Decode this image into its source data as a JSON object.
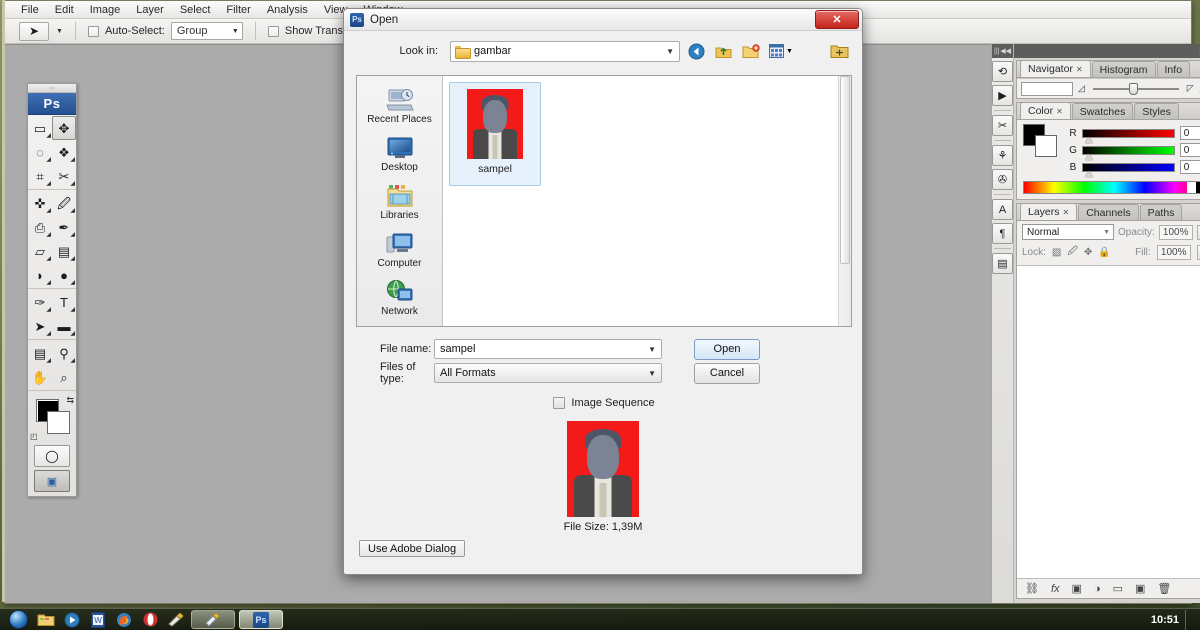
{
  "app": {
    "name": "Adobe Photoshop",
    "menus": [
      "File",
      "Edit",
      "Image",
      "Layer",
      "Select",
      "Filter",
      "Analysis",
      "View",
      "Window"
    ],
    "options_bar": {
      "tool_icon": "move-tool-icon",
      "auto_select_label": "Auto-Select:",
      "auto_select_value": "Group",
      "show_transform_label": "Show Transform Controls"
    },
    "toolbox": {
      "logo": "Ps",
      "tools": [
        {
          "name": "rectangular-marquee-tool",
          "glyph": "▭"
        },
        {
          "name": "move-tool",
          "glyph": "✥"
        },
        {
          "name": "lasso-tool",
          "glyph": "◯"
        },
        {
          "name": "magic-wand-tool",
          "glyph": "✎"
        },
        {
          "name": "crop-tool",
          "glyph": "⌗"
        },
        {
          "name": "slice-tool",
          "glyph": "✂"
        },
        {
          "name": "spot-healing-brush-tool",
          "glyph": "✜"
        },
        {
          "name": "brush-tool",
          "glyph": "🖌"
        },
        {
          "name": "clone-stamp-tool",
          "glyph": "⎙"
        },
        {
          "name": "history-brush-tool",
          "glyph": "✒"
        },
        {
          "name": "eraser-tool",
          "glyph": "▰"
        },
        {
          "name": "gradient-tool",
          "glyph": "▤"
        },
        {
          "name": "blur-tool",
          "glyph": "💧"
        },
        {
          "name": "dodge-tool",
          "glyph": "●"
        },
        {
          "name": "pen-tool",
          "glyph": "✑"
        },
        {
          "name": "type-tool",
          "glyph": "T"
        },
        {
          "name": "path-selection-tool",
          "glyph": "➤"
        },
        {
          "name": "rectangle-tool",
          "glyph": "▬"
        },
        {
          "name": "notes-tool",
          "glyph": "▤"
        },
        {
          "name": "eyedropper-tool",
          "glyph": "⚲"
        },
        {
          "name": "hand-tool",
          "glyph": "✋"
        },
        {
          "name": "zoom-tool",
          "glyph": "🔍"
        }
      ],
      "foreground_color": "#000000",
      "background_color": "#ffffff"
    },
    "canvas_color": "#ababab"
  },
  "dock": {
    "strip_icons": [
      "history-icon",
      "actions-icon",
      "tool-presets-icon",
      "clone-source-icon",
      "brushes-icon",
      "character-icon",
      "paragraph-icon",
      "layer-comps-icon"
    ],
    "navigator_panel": {
      "tabs": [
        {
          "label": "Navigator",
          "closable": true,
          "active": true
        },
        {
          "label": "Histogram",
          "closable": false,
          "active": false
        },
        {
          "label": "Info",
          "closable": false,
          "active": false
        }
      ],
      "zoom_value": ""
    },
    "color_panel": {
      "tabs": [
        {
          "label": "Color",
          "closable": true,
          "active": true
        },
        {
          "label": "Swatches",
          "closable": false,
          "active": false
        },
        {
          "label": "Styles",
          "closable": false,
          "active": false
        }
      ],
      "channels": [
        {
          "name": "R",
          "value": "0",
          "color": "#ff0000"
        },
        {
          "name": "G",
          "value": "0",
          "color": "#00ff00"
        },
        {
          "name": "B",
          "value": "0",
          "color": "#0000ff"
        }
      ],
      "foreground": "#000000",
      "background": "#ffffff"
    },
    "layers_panel": {
      "tabs": [
        {
          "label": "Layers",
          "closable": true,
          "active": true
        },
        {
          "label": "Channels",
          "closable": false,
          "active": false
        },
        {
          "label": "Paths",
          "closable": false,
          "active": false
        }
      ],
      "blend_mode": "Normal",
      "opacity_label": "Opacity:",
      "opacity_value": "100%",
      "lock_label": "Lock:",
      "fill_label": "Fill:",
      "fill_value": "100%",
      "lock_icons": [
        "lock-transparent-pixels-icon",
        "lock-image-pixels-icon",
        "lock-position-icon",
        "lock-all-icon"
      ],
      "footer_icons": [
        "link-layers-icon",
        "layer-style-icon",
        "layer-mask-icon",
        "adjustment-layer-icon",
        "new-group-icon",
        "new-layer-icon",
        "delete-layer-icon"
      ]
    }
  },
  "dialog": {
    "title": "Open",
    "icon": "Ps",
    "close_label": "✕",
    "look_in_label": "Look in:",
    "look_in_value": "gambar",
    "toolbar_icons": [
      "back-navigation-icon",
      "up-one-level-icon",
      "create-new-folder-icon",
      "views-dropdown-icon",
      "organize-icon"
    ],
    "places": [
      {
        "label": "Recent Places",
        "icon": "recent-places-icon"
      },
      {
        "label": "Desktop",
        "icon": "desktop-icon"
      },
      {
        "label": "Libraries",
        "icon": "libraries-icon"
      },
      {
        "label": "Computer",
        "icon": "computer-icon"
      },
      {
        "label": "Network",
        "icon": "network-icon"
      }
    ],
    "files": [
      {
        "label": "sampel",
        "selected": true,
        "thumb": "portrait-red-background"
      }
    ],
    "file_name_label": "File name:",
    "file_name_value": "sampel",
    "files_of_type_label": "Files of type:",
    "files_of_type_value": "All Formats",
    "open_button": "Open",
    "cancel_button": "Cancel",
    "image_sequence_label": "Image Sequence",
    "image_sequence_checked": false,
    "preview_file_size": "File Size: 1,39M",
    "use_adobe_dialog_button": "Use Adobe Dialog",
    "accent_color": "#c42318"
  },
  "taskbar": {
    "start_label": "start-orb-icon",
    "quick_launch": [
      "windows-explorer-icon",
      "media-player-icon",
      "word-icon",
      "firefox-icon",
      "opera-icon",
      "paint-icon"
    ],
    "windows": [
      {
        "label": "",
        "icon": "paint-window-icon",
        "active": false
      },
      {
        "label": "",
        "icon": "photoshop-window-icon",
        "active": true
      }
    ],
    "clock": "10:51"
  }
}
